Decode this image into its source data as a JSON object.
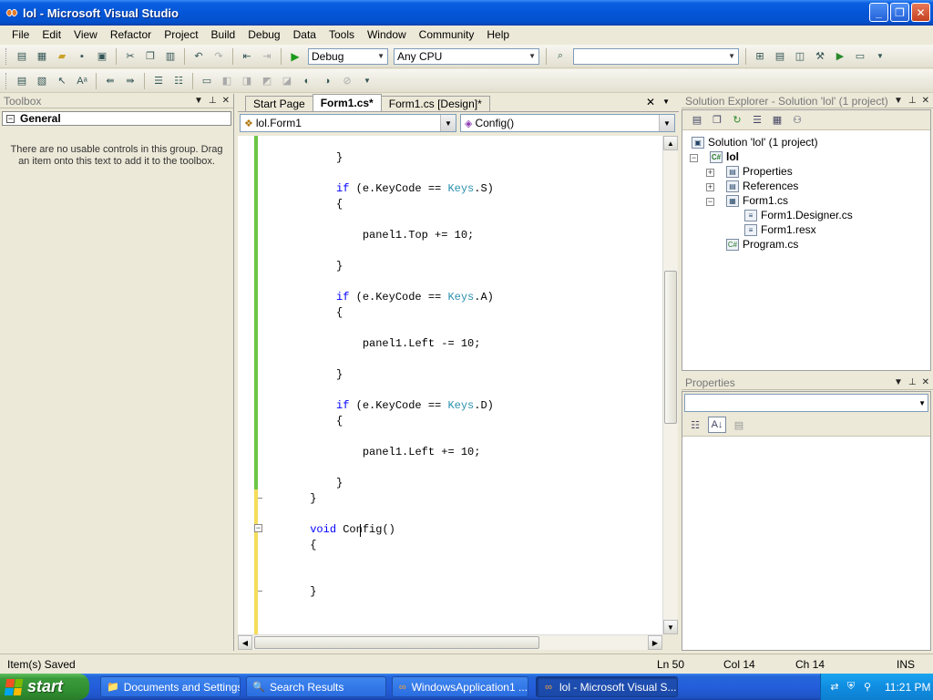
{
  "window": {
    "title": "lol - Microsoft Visual Studio",
    "buttons": {
      "minimize": "_",
      "maximize": "❐",
      "close": "✕"
    }
  },
  "menu": [
    "File",
    "Edit",
    "View",
    "Refactor",
    "Project",
    "Build",
    "Debug",
    "Data",
    "Tools",
    "Window",
    "Community",
    "Help"
  ],
  "toolbar": {
    "config": "Debug",
    "platform": "Any CPU",
    "find": ""
  },
  "toolbox": {
    "title": "Toolbox",
    "group": "General",
    "group_toggle": "−",
    "empty_text": "There are no usable controls in this group. Drag an item onto this text to add it to the toolbox."
  },
  "editor": {
    "tabs": [
      {
        "label": "Start Page",
        "active": false
      },
      {
        "label": "Form1.cs*",
        "active": true
      },
      {
        "label": "Form1.cs [Design]*",
        "active": false
      }
    ],
    "class_combo": "lol.Form1",
    "member_combo": "Config()",
    "code": [
      {
        "indent": "          ",
        "parts": [
          [
            "",
            "}"
          ]
        ]
      },
      {
        "indent": "",
        "parts": []
      },
      {
        "indent": "          ",
        "parts": [
          [
            "kw",
            "if"
          ],
          [
            "",
            " (e.KeyCode == "
          ],
          [
            "ty",
            "Keys"
          ],
          [
            "",
            ".S)"
          ]
        ]
      },
      {
        "indent": "          ",
        "parts": [
          [
            "",
            "{"
          ]
        ]
      },
      {
        "indent": "",
        "parts": []
      },
      {
        "indent": "              ",
        "parts": [
          [
            "",
            "panel1.Top += 10;"
          ]
        ]
      },
      {
        "indent": "",
        "parts": []
      },
      {
        "indent": "          ",
        "parts": [
          [
            "",
            "}"
          ]
        ]
      },
      {
        "indent": "",
        "parts": []
      },
      {
        "indent": "          ",
        "parts": [
          [
            "kw",
            "if"
          ],
          [
            "",
            " (e.KeyCode == "
          ],
          [
            "ty",
            "Keys"
          ],
          [
            "",
            ".A)"
          ]
        ]
      },
      {
        "indent": "          ",
        "parts": [
          [
            "",
            "{"
          ]
        ]
      },
      {
        "indent": "",
        "parts": []
      },
      {
        "indent": "              ",
        "parts": [
          [
            "",
            "panel1.Left -= 10;"
          ]
        ]
      },
      {
        "indent": "",
        "parts": []
      },
      {
        "indent": "          ",
        "parts": [
          [
            "",
            "}"
          ]
        ]
      },
      {
        "indent": "",
        "parts": []
      },
      {
        "indent": "          ",
        "parts": [
          [
            "kw",
            "if"
          ],
          [
            "",
            " (e.KeyCode == "
          ],
          [
            "ty",
            "Keys"
          ],
          [
            "",
            ".D)"
          ]
        ]
      },
      {
        "indent": "          ",
        "parts": [
          [
            "",
            "{"
          ]
        ]
      },
      {
        "indent": "",
        "parts": []
      },
      {
        "indent": "              ",
        "parts": [
          [
            "",
            "panel1.Left += 10;"
          ]
        ]
      },
      {
        "indent": "",
        "parts": []
      },
      {
        "indent": "          ",
        "parts": [
          [
            "",
            "}"
          ]
        ]
      },
      {
        "indent": "      ",
        "parts": [
          [
            "",
            "}"
          ]
        ]
      },
      {
        "indent": "",
        "parts": []
      },
      {
        "indent": "      ",
        "parts": [
          [
            "kw",
            "void"
          ],
          [
            "",
            " Config()"
          ]
        ]
      },
      {
        "indent": "      ",
        "parts": [
          [
            "",
            "{"
          ]
        ]
      },
      {
        "indent": "",
        "parts": []
      },
      {
        "indent": "",
        "parts": []
      },
      {
        "indent": "      ",
        "parts": [
          [
            "",
            "}"
          ]
        ]
      }
    ]
  },
  "solution_explorer": {
    "title": "Solution Explorer - Solution 'lol' (1 project)",
    "tree": [
      {
        "label": "Solution 'lol' (1 project)",
        "icon": "solution-icon",
        "glyph": "▣"
      },
      {
        "label": "lol",
        "icon": "csharp-project-icon",
        "glyph": "C#",
        "bold": true
      },
      {
        "label": "Properties",
        "icon": "properties-folder-icon",
        "glyph": "▤"
      },
      {
        "label": "References",
        "icon": "references-folder-icon",
        "glyph": "▤"
      },
      {
        "label": "Form1.cs",
        "icon": "form-icon",
        "glyph": "▦"
      },
      {
        "label": "Form1.Designer.cs",
        "icon": "cs-file-icon",
        "glyph": "≡"
      },
      {
        "label": "Form1.resx",
        "icon": "resx-file-icon",
        "glyph": "≡"
      },
      {
        "label": "Program.cs",
        "icon": "cs-file-icon",
        "glyph": "C#"
      }
    ]
  },
  "properties": {
    "title": "Properties",
    "object": ""
  },
  "status": {
    "message": "Item(s) Saved",
    "ln": "Ln 50",
    "col": "Col 14",
    "ch": "Ch 14",
    "mode": "INS"
  },
  "taskbar": {
    "start": "start",
    "tasks": [
      {
        "label": "Documents and Settings",
        "icon": "folder-icon",
        "glyph": "📁",
        "active": false
      },
      {
        "label": "Search Results",
        "icon": "search-results-icon",
        "glyph": "🔍",
        "active": false
      },
      {
        "label": "WindowsApplication1 ...",
        "icon": "visual-studio-icon",
        "glyph": "∞",
        "active": false
      },
      {
        "label": "lol - Microsoft Visual S...",
        "icon": "visual-studio-icon",
        "glyph": "∞",
        "active": true
      }
    ],
    "clock": "11:21 PM"
  },
  "colors": {
    "keyword": "#0000ff",
    "type": "#2b91af",
    "change_saved": "#6cc644",
    "change_unsaved": "#f5dc5a"
  }
}
